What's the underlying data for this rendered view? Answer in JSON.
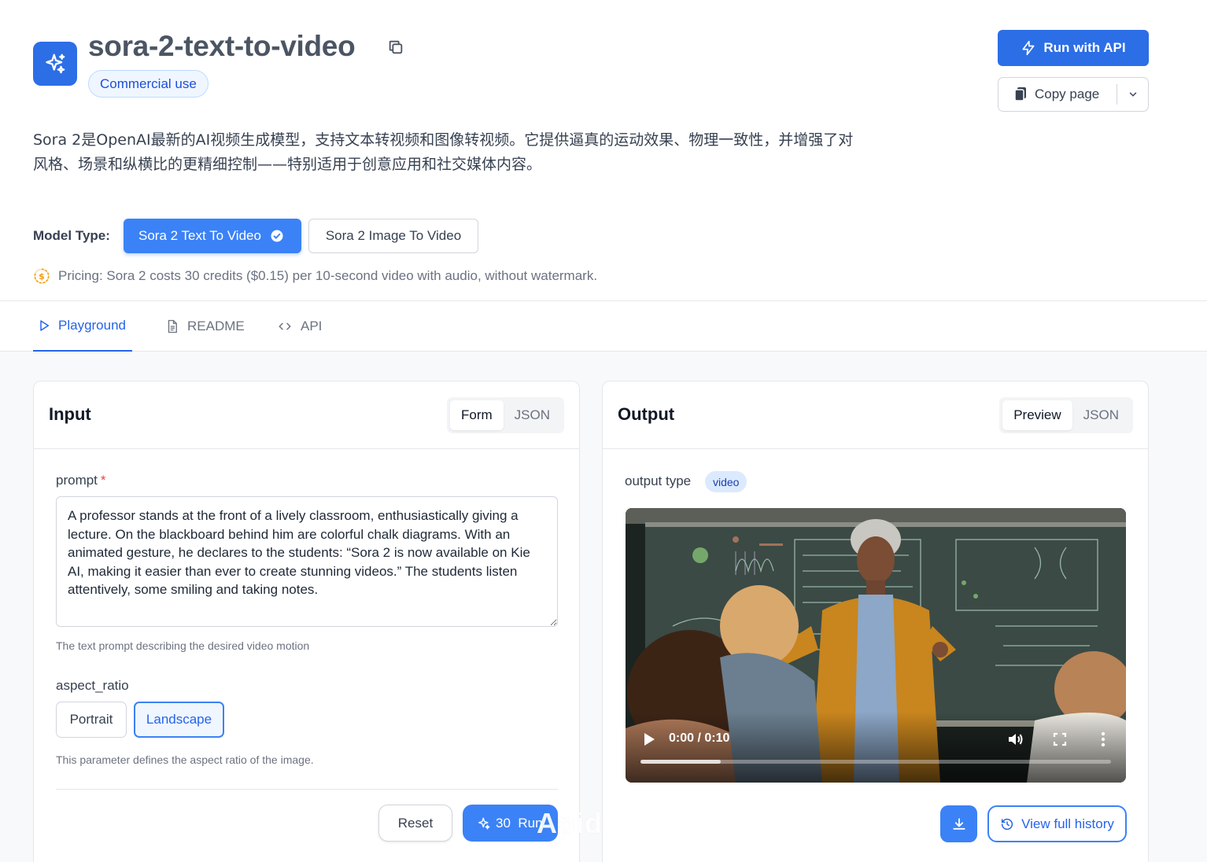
{
  "header": {
    "title": "sora-2-text-to-video",
    "badge": "Commercial use",
    "run_api_label": "Run with API",
    "copy_page_label": "Copy page",
    "description": "Sora 2是OpenAI最新的AI视频生成模型，支持文本转视频和图像转视频。它提供逼真的运动效果、物理一致性，并增强了对风格、场景和纵横比的更精细控制——特别适用于创意应用和社交媒体内容。"
  },
  "model_type": {
    "label": "Model Type:",
    "options": [
      "Sora 2 Text To Video",
      "Sora 2 Image To Video"
    ],
    "selected": "Sora 2 Text To Video"
  },
  "pricing": "Pricing: Sora 2 costs 30 credits ($0.15) per 10-second video with audio, without watermark.",
  "tabs": [
    {
      "label": "Playground",
      "icon": "play-icon",
      "active": true
    },
    {
      "label": "README",
      "icon": "document-icon",
      "active": false
    },
    {
      "label": "API",
      "icon": "code-icon",
      "active": false
    }
  ],
  "input_panel": {
    "title": "Input",
    "view_toggle": [
      "Form",
      "JSON"
    ],
    "view_selected": "Form",
    "prompt": {
      "label": "prompt",
      "required_mark": "*",
      "value": "A professor stands at the front of a lively classroom, enthusiastically giving a lecture. On the blackboard behind him are colorful chalk diagrams. With an animated gesture, he declares to the students: “Sora 2 is now available on Kie AI, making it easier than ever to create stunning videos.” The students listen attentively, some smiling and taking notes.",
      "hint": "The text prompt describing the desired video motion"
    },
    "aspect_ratio": {
      "label": "aspect_ratio",
      "options": [
        "Portrait",
        "Landscape"
      ],
      "selected": "Landscape",
      "hint": "This parameter defines the aspect ratio of the image."
    },
    "reset_label": "Reset",
    "run_label": "30  Run"
  },
  "output_panel": {
    "title": "Output",
    "view_toggle": [
      "Preview",
      "JSON"
    ],
    "view_selected": "Preview",
    "output_type_label": "output type",
    "output_type_value": "video",
    "video": {
      "time": "0:00 / 0:10",
      "buffered_fraction": 0.17
    },
    "history_label": "View full history"
  },
  "watermark_text": "Apidog",
  "colors": {
    "primary": "#2c6ee6",
    "accent": "#3b82f6",
    "required": "#ef4444",
    "pricing_icon": "#f59e0b"
  }
}
